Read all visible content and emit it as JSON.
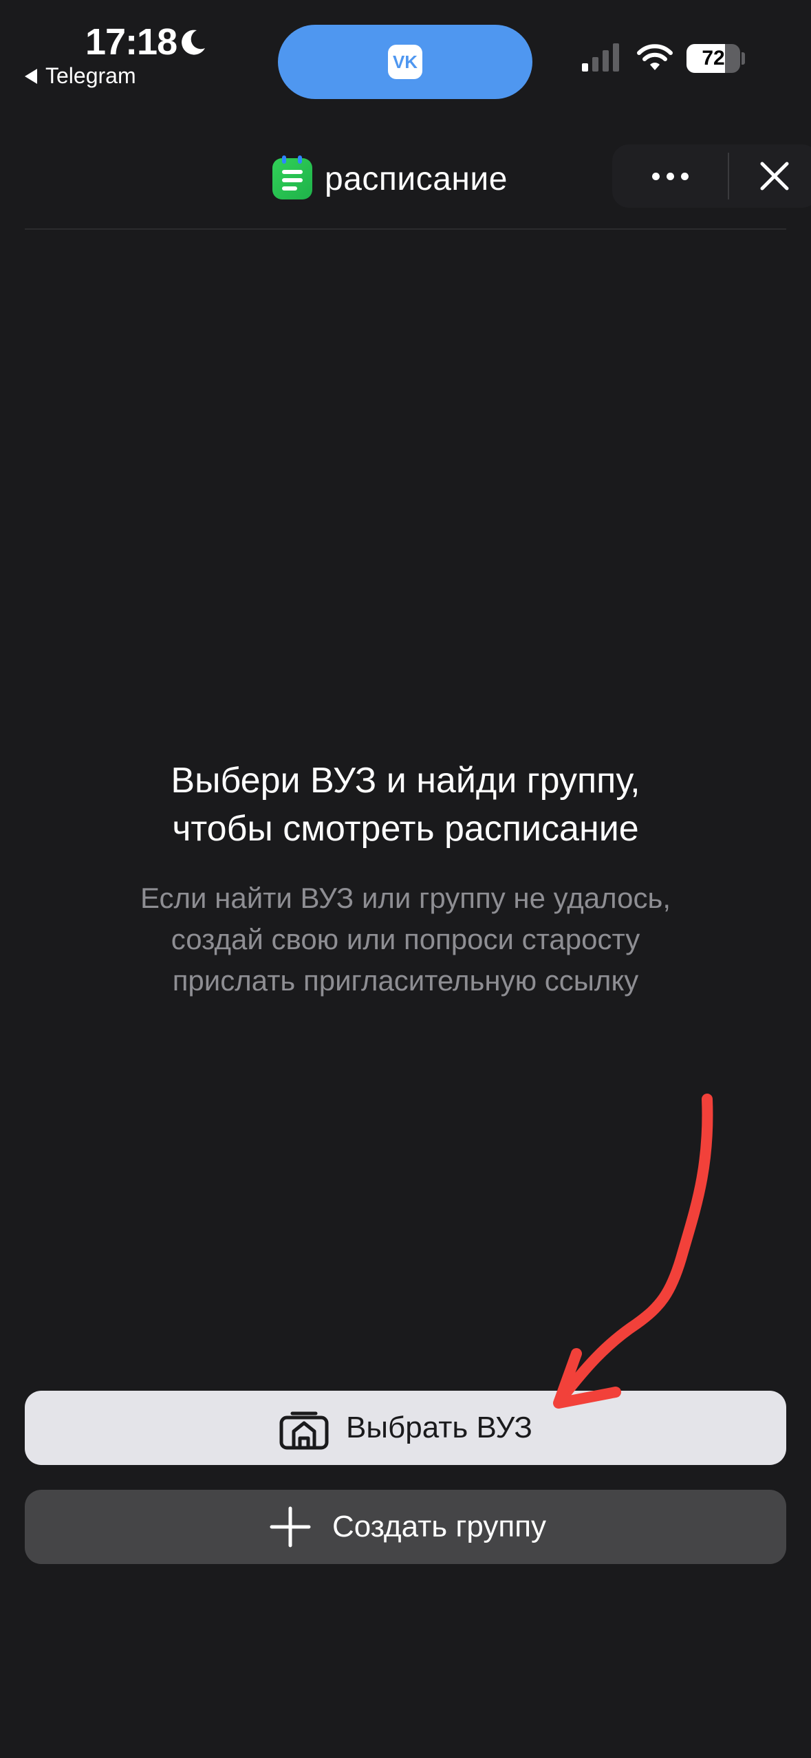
{
  "status_bar": {
    "time": "17:18",
    "back_app": "Telegram",
    "battery_percent": "72",
    "battery_level": 0.72,
    "island_app_icon": "vk-icon",
    "island_app_text": "VK",
    "island_color": "#4f97f0"
  },
  "header": {
    "title": "расписание",
    "logo_icon": "calendar-list-icon",
    "more_icon": "ellipsis-icon",
    "close_icon": "close-icon"
  },
  "empty_state": {
    "title_line1": "Выбери ВУЗ и найди группу,",
    "title_line2": "чтобы смотреть расписание",
    "subtitle_line1": "Если найти ВУЗ или группу не удалось,",
    "subtitle_line2": "создай свою или попроси старосту",
    "subtitle_line3": "прислать пригласительную ссылку"
  },
  "actions": {
    "choose_university_label": "Выбрать ВУЗ",
    "choose_university_icon": "university-icon",
    "create_group_label": "Создать группу",
    "create_group_icon": "plus-icon"
  },
  "colors": {
    "background": "#1a1a1c",
    "primary_button": "#e4e4e9",
    "secondary_button": "#454547",
    "annotation": "#f2413a"
  }
}
